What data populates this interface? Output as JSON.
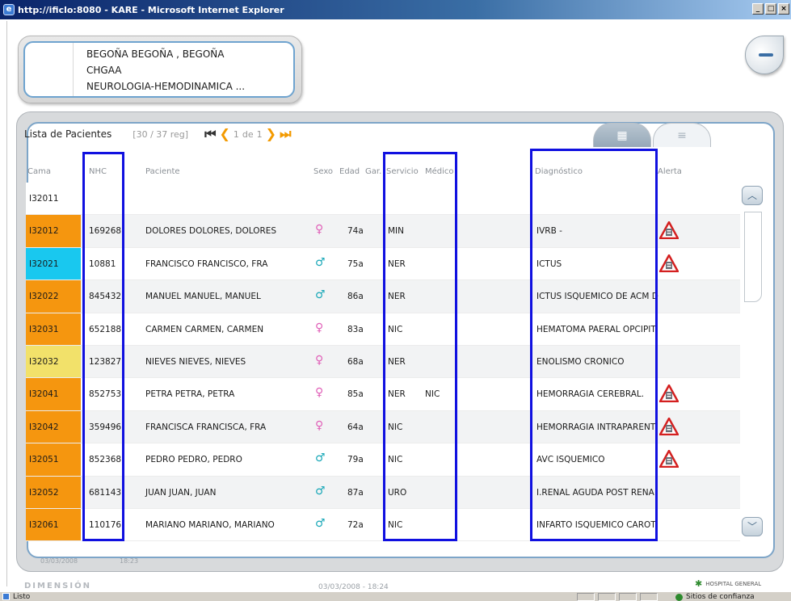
{
  "window": {
    "title": "http://ificlo:8080 - KARE - Microsoft Internet Explorer"
  },
  "patient": {
    "name": "BEGOÑA BEGOÑA , BEGOÑA",
    "code": "CHGAA",
    "service": "NEUROLOGIA-HEMODINAMICA ..."
  },
  "list": {
    "title": "Lista de Pacientes",
    "count": "[30 / 37 reg]",
    "page_current": "1",
    "page_of": "de",
    "page_total": "1"
  },
  "columns": {
    "cama": "Cama",
    "nhc": "NHC",
    "paciente": "Paciente",
    "sexo": "Sexo",
    "edad": "Edad",
    "gar": "Gar.",
    "servicio": "Servicio",
    "medico": "Médico",
    "diagnostico": "Diagnóstico",
    "alerta": "Alerta"
  },
  "rows": [
    {
      "cama": "I32011",
      "color": "#ffffff",
      "nhc": "",
      "paciente": "",
      "sexo": "",
      "edad": "",
      "servicio": "",
      "medico": "",
      "diagnostico": "",
      "alerta": false
    },
    {
      "cama": "I32012",
      "color": "#f5960f",
      "nhc": "169268",
      "paciente": "DOLORES DOLORES, DOLORES",
      "sexo": "F",
      "edad": "74a",
      "servicio": "MIN",
      "medico": "",
      "diagnostico": "IVRB -",
      "alerta": true
    },
    {
      "cama": "I32021",
      "color": "#19c8ef",
      "nhc": "10881",
      "paciente": "FRANCISCO FRANCISCO, FRA",
      "sexo": "M",
      "edad": "75a",
      "servicio": "NER",
      "medico": "",
      "diagnostico": "ICTUS",
      "alerta": true
    },
    {
      "cama": "I32022",
      "color": "#f5960f",
      "nhc": "845432",
      "paciente": "MANUEL MANUEL, MANUEL",
      "sexo": "M",
      "edad": "86a",
      "servicio": "NER",
      "medico": "",
      "diagnostico": "ICTUS ISQUEMICO DE ACM D",
      "alerta": false
    },
    {
      "cama": "I32031",
      "color": "#f5960f",
      "nhc": "652188",
      "paciente": "CARMEN CARMEN, CARMEN",
      "sexo": "F",
      "edad": "83a",
      "servicio": "NIC",
      "medico": "",
      "diagnostico": "HEMATOMA PAERAL OPCIPIT",
      "alerta": false
    },
    {
      "cama": "I32032",
      "color": "#f2e16a",
      "nhc": "123827",
      "paciente": "NIEVES NIEVES, NIEVES",
      "sexo": "F",
      "edad": "68a",
      "servicio": "NER",
      "medico": "",
      "diagnostico": "ENOLISMO CRONICO",
      "alerta": false
    },
    {
      "cama": "I32041",
      "color": "#f5960f",
      "nhc": "852753",
      "paciente": "PETRA PETRA, PETRA",
      "sexo": "F",
      "edad": "85a",
      "servicio": "NER",
      "medico": "NIC",
      "diagnostico": "HEMORRAGIA CEREBRAL.",
      "alerta": true
    },
    {
      "cama": "I32042",
      "color": "#f5960f",
      "nhc": "359496",
      "paciente": "FRANCISCA FRANCISCA, FRA",
      "sexo": "F",
      "edad": "64a",
      "servicio": "NIC",
      "medico": "",
      "diagnostico": "HEMORRAGIA INTRAPARENT",
      "alerta": true
    },
    {
      "cama": "I32051",
      "color": "#f5960f",
      "nhc": "852368",
      "paciente": "PEDRO PEDRO, PEDRO",
      "sexo": "M",
      "edad": "79a",
      "servicio": "NIC",
      "medico": "",
      "diagnostico": "AVC ISQUEMICO",
      "alerta": true
    },
    {
      "cama": "I32052",
      "color": "#f5960f",
      "nhc": "681143",
      "paciente": "JUAN JUAN, JUAN",
      "sexo": "M",
      "edad": "87a",
      "servicio": "URO",
      "medico": "",
      "diagnostico": "I.RENAL AGUDA POST RENA",
      "alerta": false
    },
    {
      "cama": "I32061",
      "color": "#f5960f",
      "nhc": "110176",
      "paciente": "MARIANO MARIANO, MARIANO",
      "sexo": "M",
      "edad": "72a",
      "servicio": "NIC",
      "medico": "",
      "diagnostico": "INFARTO ISQUEMICO CAROT",
      "alerta": false
    }
  ],
  "footer": {
    "panel_date": "03/03/2008",
    "panel_time": "18:23",
    "brand": "DIMENSIÓN",
    "bottom_date": "03/03/2008 - 18:24",
    "hospital": "HOSPITAL GENERAL"
  },
  "statusbar": {
    "text": "Listo",
    "zone": "Sitios de confianza"
  },
  "colors": {
    "highlight": "#1010e0",
    "accent": "#7da5c8"
  }
}
